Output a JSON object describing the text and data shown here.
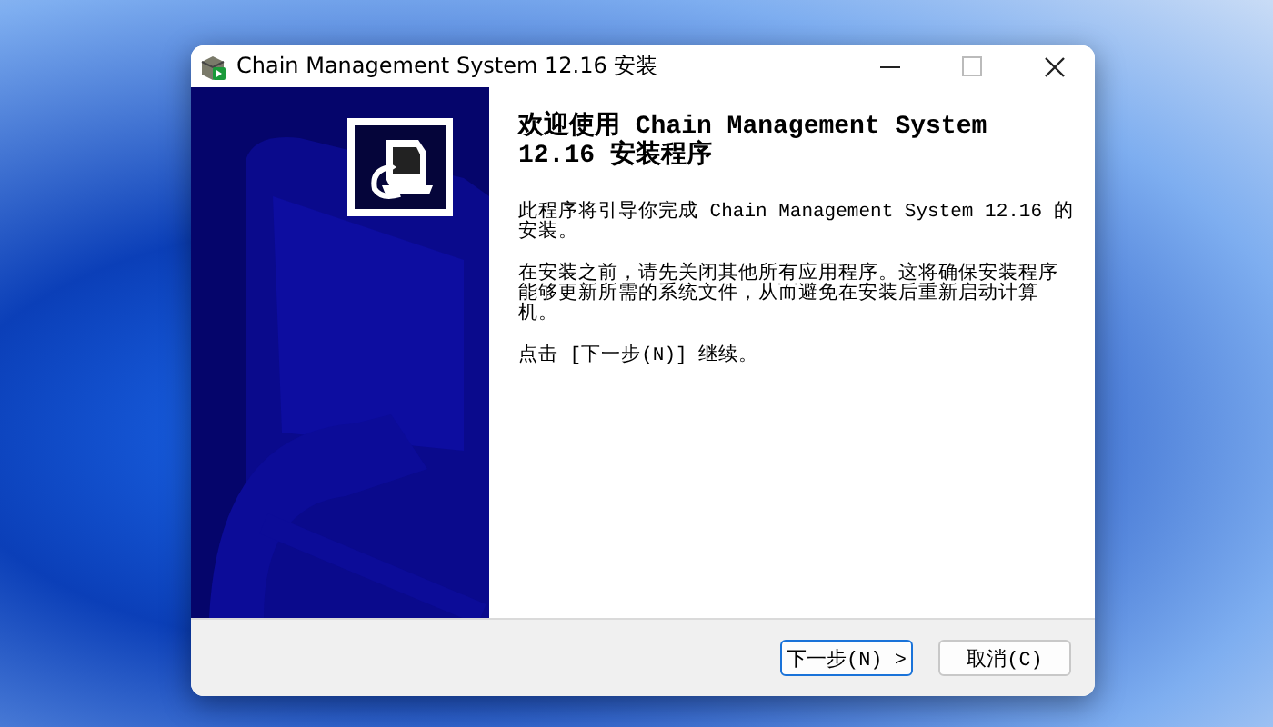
{
  "window": {
    "title": "Chain Management System 12.16 安装"
  },
  "welcome": {
    "heading": "欢迎使用 Chain Management System 12.16 安装程序",
    "paragraphs": [
      "此程序将引导你完成 Chain Management System 12.16 的安装。",
      "在安装之前，请先关闭其他所有应用程序。这将确保安装程序能够更新所需的系统文件，从而避免在安装后重新启动计算机。",
      "点击 [下一步(N)] 继续。"
    ]
  },
  "buttons": [
    {
      "label": "下一步(N) >",
      "default": true
    },
    {
      "label": "取消(C)",
      "default": false
    }
  ]
}
